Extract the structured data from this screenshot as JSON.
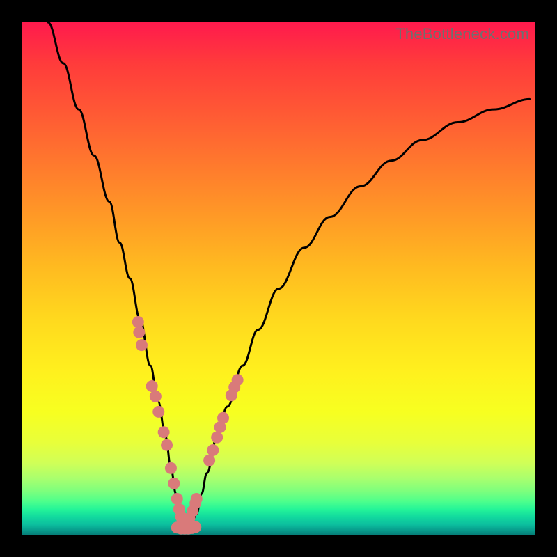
{
  "watermark": "TheBottleneck.com",
  "chart_data": {
    "type": "line",
    "title": "",
    "xlabel": "",
    "ylabel": "",
    "xlim": [
      0,
      100
    ],
    "ylim": [
      0,
      100
    ],
    "series": [
      {
        "name": "curve",
        "x": [
          5,
          8,
          11,
          14,
          17,
          19,
          21,
          23,
          25,
          26.5,
          28,
          29,
          30,
          30.8,
          31.4,
          32,
          33,
          34,
          35,
          36,
          38,
          40,
          43,
          46,
          50,
          55,
          60,
          66,
          72,
          78,
          85,
          92,
          99
        ],
        "values": [
          100,
          92,
          83,
          74,
          65,
          57,
          50,
          42,
          33,
          26,
          19,
          13,
          8,
          4,
          2,
          1.5,
          2,
          4,
          8,
          12,
          19,
          25,
          33,
          40,
          48,
          56,
          62,
          68,
          73,
          77,
          80.5,
          83,
          85
        ]
      },
      {
        "name": "left-dots",
        "x": [
          22.6,
          22.8,
          23.3,
          25.3,
          26.0,
          26.6,
          27.6,
          28.2,
          29.0,
          29.6,
          30.2,
          30.6,
          31.0,
          31.3
        ],
        "values": [
          41.5,
          39.5,
          37.0,
          29.0,
          27.0,
          24.0,
          20.0,
          17.5,
          13.0,
          10.0,
          7.0,
          5.0,
          3.5,
          2.8
        ]
      },
      {
        "name": "right-dots",
        "x": [
          32.2,
          32.6,
          33.2,
          33.8,
          34.0,
          36.5,
          37.2,
          38.0,
          38.6,
          39.2,
          40.8,
          41.4,
          42.0
        ],
        "values": [
          2.4,
          3.2,
          4.6,
          6.2,
          7.0,
          14.5,
          16.5,
          19.0,
          21.0,
          22.8,
          27.2,
          28.8,
          30.2
        ]
      },
      {
        "name": "bottom-dots",
        "x": [
          30.2,
          31.0,
          31.7,
          32.4,
          33.1,
          33.8
        ],
        "values": [
          1.4,
          1.2,
          1.2,
          1.2,
          1.3,
          1.5
        ]
      }
    ],
    "colors": {
      "curve": "#000000",
      "dots": "#d97a7a"
    }
  }
}
